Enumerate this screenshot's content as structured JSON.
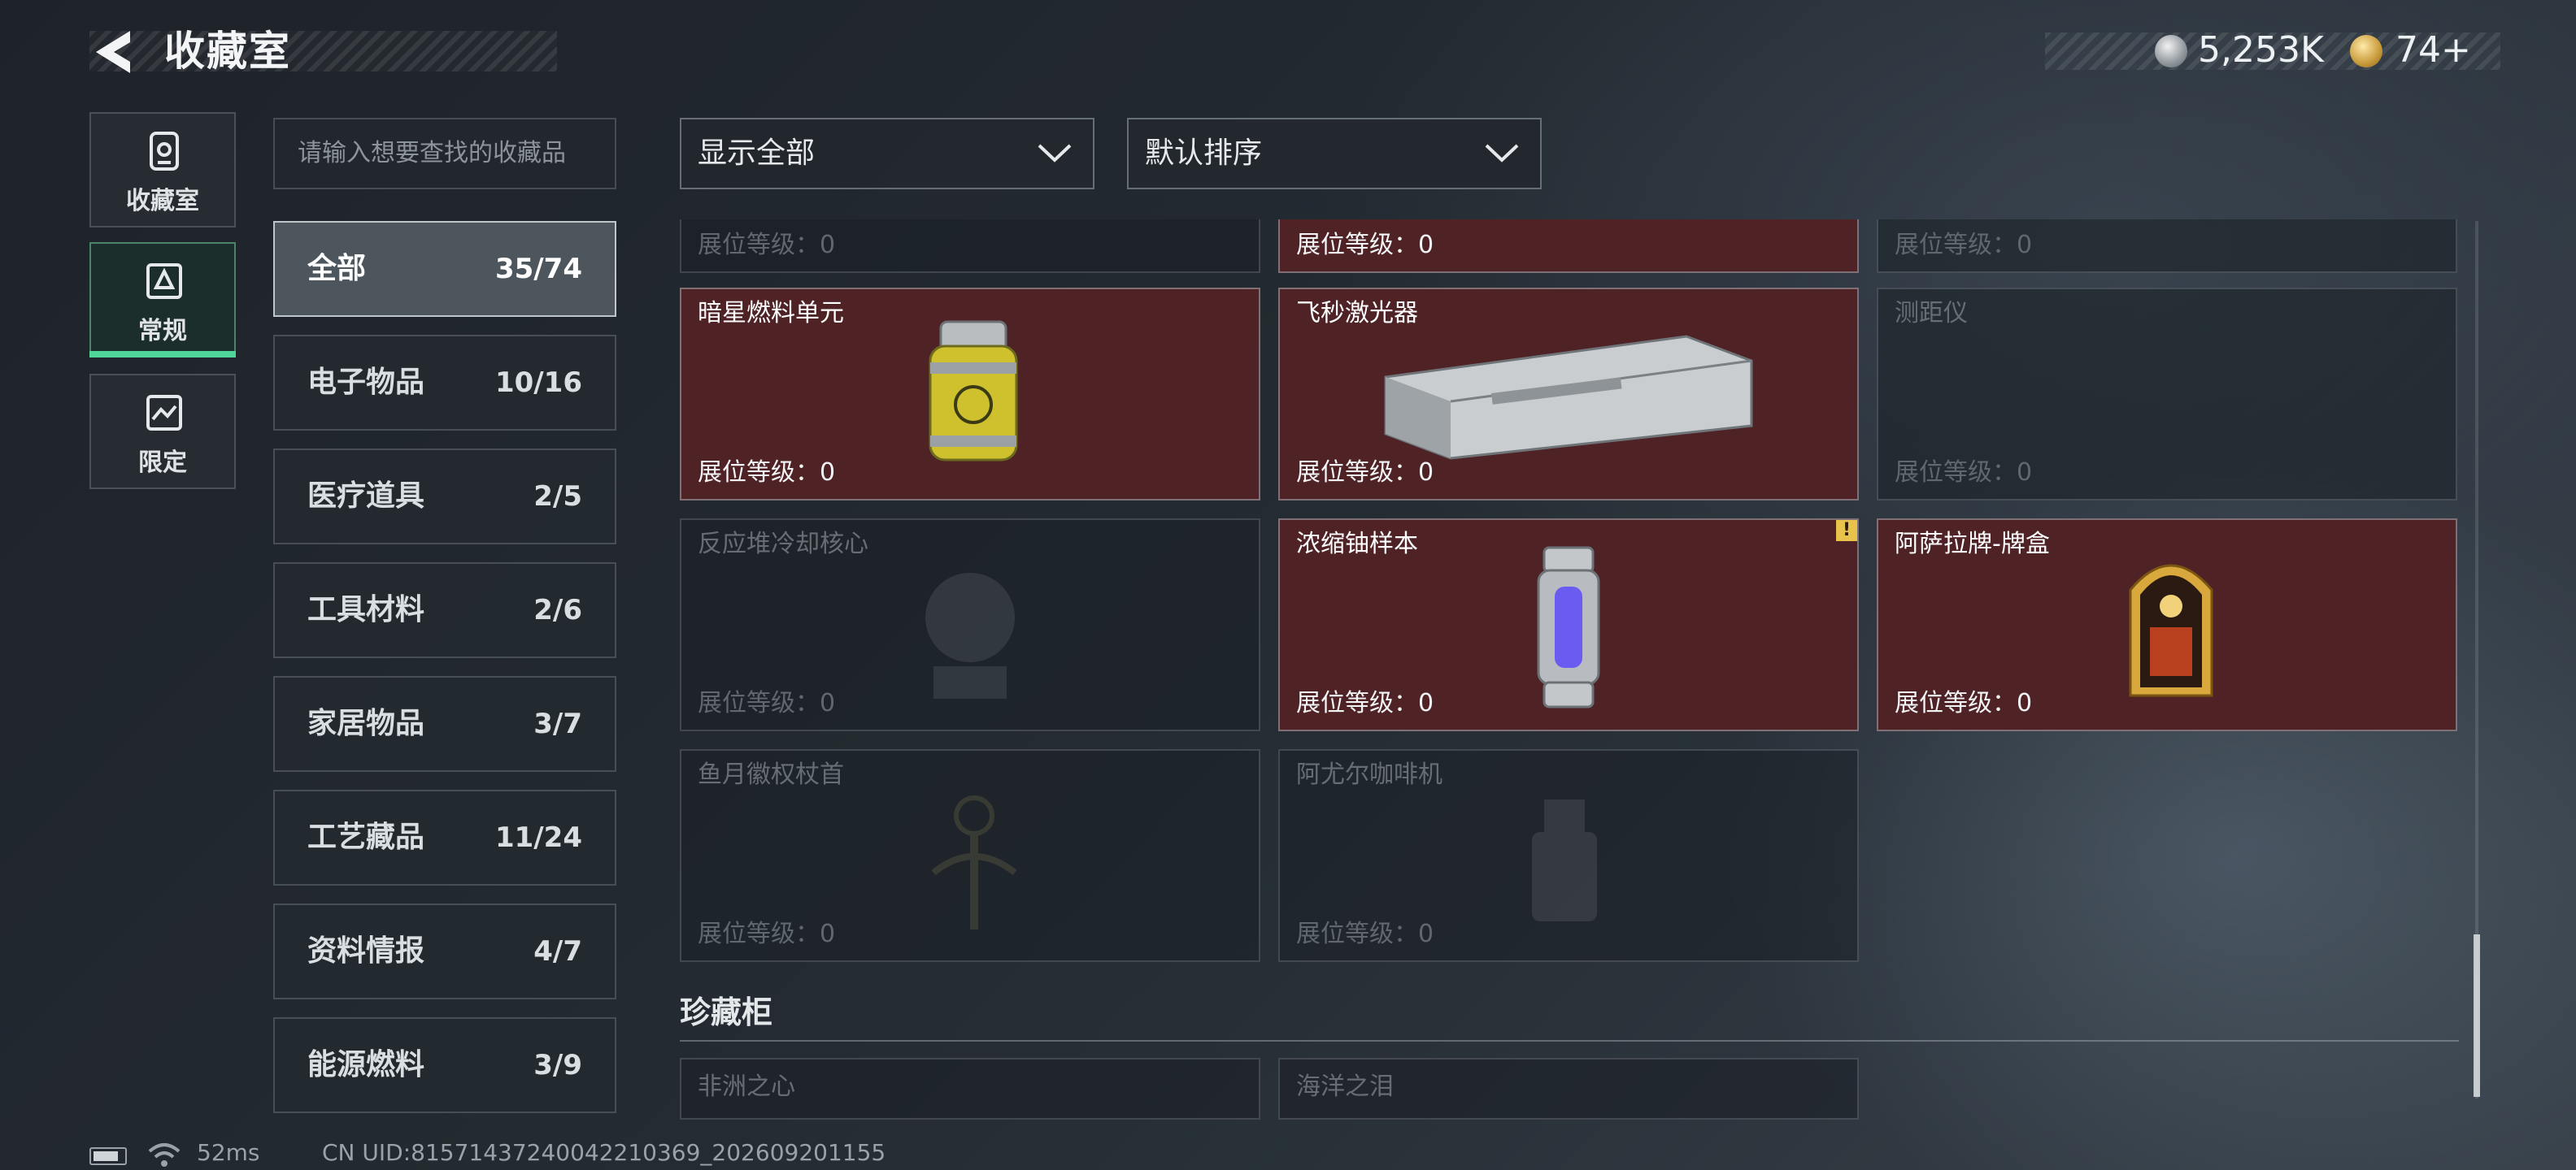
{
  "header": {
    "title": "收藏室",
    "currency_silver": "5,253K",
    "currency_gold": "74+"
  },
  "rail": [
    {
      "label": "收藏室",
      "icon": "collection-room-icon"
    },
    {
      "label": "常规",
      "icon": "regular-icon",
      "active": true
    },
    {
      "label": "限定",
      "icon": "limited-icon"
    }
  ],
  "search": {
    "placeholder": "请输入想要查找的收藏品"
  },
  "categories": [
    {
      "name": "全部",
      "count": "35/74",
      "active": true
    },
    {
      "name": "电子物品",
      "count": "10/16"
    },
    {
      "name": "医疗道具",
      "count": "2/5"
    },
    {
      "name": "工具材料",
      "count": "2/6"
    },
    {
      "name": "家居物品",
      "count": "3/7"
    },
    {
      "name": "工艺藏品",
      "count": "11/24"
    },
    {
      "name": "资料情报",
      "count": "4/7"
    },
    {
      "name": "能源燃料",
      "count": "3/9"
    }
  ],
  "filters": {
    "show": "显示全部",
    "sort": "默认排序"
  },
  "level_label": "展位等级：0",
  "cut_row": [
    {
      "owned": false
    },
    {
      "owned": true
    },
    {
      "owned": false
    }
  ],
  "items": [
    {
      "name": "暗星燃料单元",
      "owned": true,
      "icon": "fuel-canister-icon"
    },
    {
      "name": "飞秒激光器",
      "owned": true,
      "icon": "laser-device-icon"
    },
    {
      "name": "测距仪",
      "owned": false,
      "icon": "rangefinder-icon"
    },
    {
      "name": "反应堆冷却核心",
      "owned": false,
      "icon": "reactor-core-icon"
    },
    {
      "name": "浓缩铀样本",
      "owned": true,
      "icon": "uranium-capsule-icon",
      "alert": true
    },
    {
      "name": "阿萨拉牌-牌盒",
      "owned": true,
      "icon": "card-box-icon"
    },
    {
      "name": "鱼月徽权杖首",
      "owned": false,
      "icon": "scepter-head-icon"
    },
    {
      "name": "阿尤尔咖啡机",
      "owned": false,
      "icon": "coffee-machine-icon"
    }
  ],
  "section": {
    "title": "珍藏柜"
  },
  "treasures": [
    {
      "name": "非洲之心"
    },
    {
      "name": "海洋之泪"
    }
  ],
  "footer": {
    "ping": "52ms",
    "uid": "CN UID:81571437240042210369_202609201155"
  },
  "colors": {
    "owned_bg": "#4f2226",
    "accent_green": "#4fd49a",
    "alert": "#e8c24a"
  }
}
